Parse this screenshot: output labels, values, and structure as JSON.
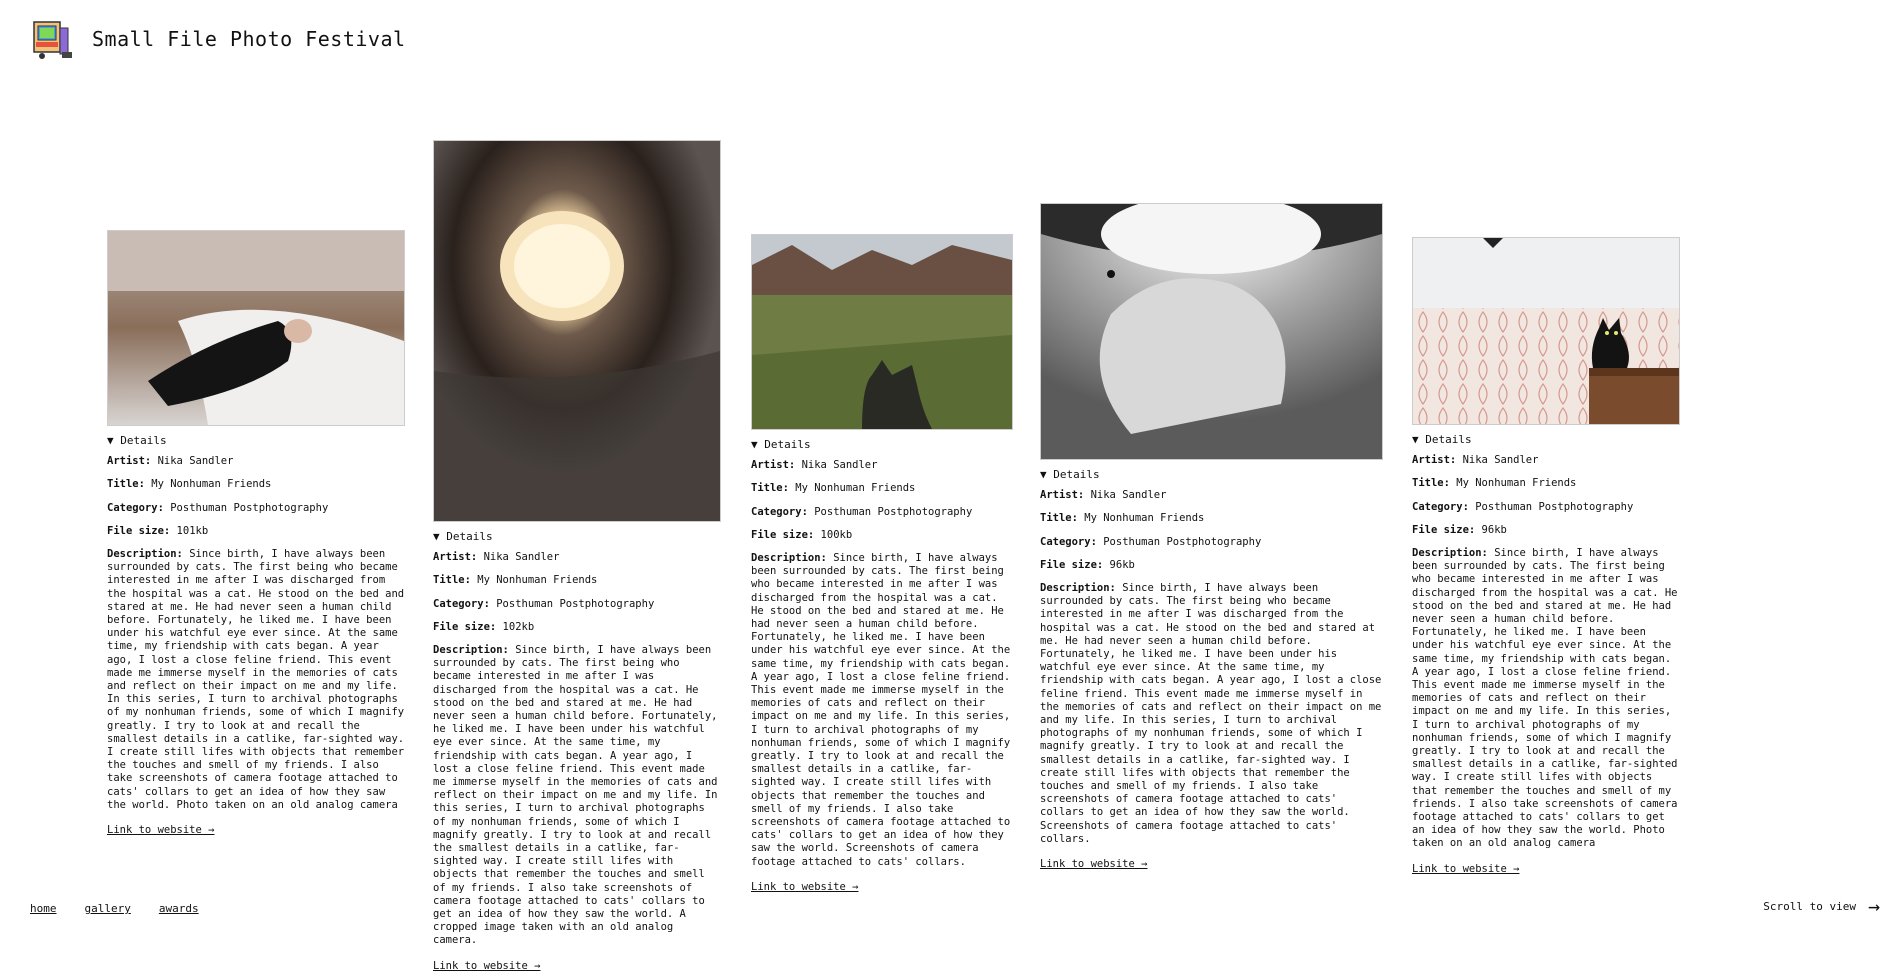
{
  "site": {
    "title": "Small File Photo Festival"
  },
  "nav": {
    "home": "home",
    "gallery": "gallery",
    "awards": "awards"
  },
  "scroll_hint": "Scroll to view",
  "labels": {
    "details": "Details",
    "artist": "Artist:",
    "title": "Title:",
    "category": "Category:",
    "file_size": "File size:",
    "description": "Description:",
    "link": "Link to website →"
  },
  "cards": [
    {
      "artist": "Nika Sandler",
      "title": "My Nonhuman Friends",
      "category": "Posthuman Postphotography",
      "file_size": "101kb",
      "description": "Since birth, I have always been surrounded by cats. The first being who became interested in me after I was discharged from the hospital was a cat. He stood on the bed and stared at me. He had never seen a human child before. Fortunately, he liked me. I have been under his watchful eye ever since. At the same time, my friendship with cats began. A year ago, I lost a close feline friend. This event made me immerse myself in the memories of cats and reflect on their impact on me and my life. In this series, I turn to archival photographs of my nonhuman friends, some of which I magnify greatly. I try to look at and recall the smallest details in a catlike, far-sighted way. I create still lifes with objects that remember the touches and smell of my friends. I also take screenshots of camera footage attached to cats' collars to get an idea of how they saw the world. Photo taken on an old analog camera"
    },
    {
      "artist": "Nika Sandler",
      "title": "My Nonhuman Friends",
      "category": "Posthuman Postphotography",
      "file_size": "102kb",
      "description": "Since birth, I have always been surrounded by cats. The first being who became interested in me after I was discharged from the hospital was a cat. He stood on the bed and stared at me. He had never seen a human child before. Fortunately, he liked me. I have been under his watchful eye ever since. At the same time, my friendship with cats began. A year ago, I lost a close feline friend. This event made me immerse myself in the memories of cats and reflect on their impact on me and my life. In this series, I turn to archival photographs of my nonhuman friends, some of which I magnify greatly. I try to look at and recall the smallest details in a catlike, far-sighted way. I create still lifes with objects that remember the touches and smell of my friends. I also take screenshots of camera footage attached to cats' collars to get an idea of how they saw the world. A cropped image taken with an old analog camera."
    },
    {
      "artist": "Nika Sandler",
      "title": "My Nonhuman Friends",
      "category": "Posthuman Postphotography",
      "file_size": "100kb",
      "description": "Since birth, I have always been surrounded by cats. The first being who became interested in me after I was discharged from the hospital was a cat. He stood on the bed and stared at me. He had never seen a human child before. Fortunately, he liked me. I have been under his watchful eye ever since. At the same time, my friendship with cats began. A year ago, I lost a close feline friend. This event made me immerse myself in the memories of cats and reflect on their impact on me and my life. In this series, I turn to archival photographs of my nonhuman friends, some of which I magnify greatly. I try to look at and recall the smallest details in a catlike, far-sighted way. I create still lifes with objects that remember the touches and smell of my friends. I also take screenshots of camera footage attached to cats' collars to get an idea of how they saw the world. Screenshots of camera footage attached to cats' collars."
    },
    {
      "artist": "Nika Sandler",
      "title": "My Nonhuman Friends",
      "category": "Posthuman Postphotography",
      "file_size": "96kb",
      "description": "Since birth, I have always been surrounded by cats. The first being who became interested in me after I was discharged from the hospital was a cat. He stood on the bed and stared at me. He had never seen a human child before. Fortunately, he liked me. I have been under his watchful eye ever since. At the same time, my friendship with cats began. A year ago, I lost a close feline friend. This event made me immerse myself in the memories of cats and reflect on their impact on me and my life. In this series, I turn to archival photographs of my nonhuman friends, some of which I magnify greatly. I try to look at and recall the smallest details in a catlike, far-sighted way. I create still lifes with objects that remember the touches and smell of my friends. I also take screenshots of camera footage attached to cats' collars to get an idea of how they saw the world. Screenshots of camera footage attached to cats' collars."
    },
    {
      "artist": "Nika Sandler",
      "title": "My Nonhuman Friends",
      "category": "Posthuman Postphotography",
      "file_size": "96kb",
      "description": "Since birth, I have always been surrounded by cats. The first being who became interested in me after I was discharged from the hospital was a cat. He stood on the bed and stared at me. He had never seen a human child before. Fortunately, he liked me. I have been under his watchful eye ever since. At the same time, my friendship with cats began. A year ago, I lost a close feline friend. This event made me immerse myself in the memories of cats and reflect on their impact on me and my life. In this series, I turn to archival photographs of my nonhuman friends, some of which I magnify greatly. I try to look at and recall the smallest details in a catlike, far-sighted way. I create still lifes with objects that remember the touches and smell of my friends. I also take screenshots of camera footage attached to cats' collars to get an idea of how they saw the world. Photo taken on an old analog camera"
    }
  ]
}
